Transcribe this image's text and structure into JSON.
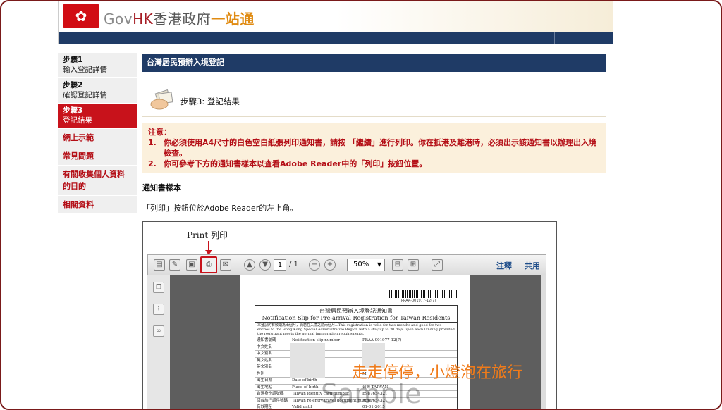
{
  "header": {
    "flag_glyph": "✿",
    "brand_gov": "Gov",
    "brand_hk": "HK",
    "brand_zh": "香港政府",
    "brand_one": "一站通"
  },
  "sidebar": {
    "steps": [
      {
        "title": "步驟1",
        "sub": "輸入登記詳情"
      },
      {
        "title": "步驟2",
        "sub": "確認登記詳情"
      },
      {
        "title": "步驟3",
        "sub": "登記結果"
      }
    ],
    "links": [
      "網上示範",
      "常見問題",
      "有關收集個人資料的目的",
      "相關資料"
    ]
  },
  "main": {
    "title": "台灣居民預辦入境登記",
    "step_label": "步驟3: 登記結果",
    "notice_heading": "注意：",
    "notice_items": [
      "你必須使用A4尺寸的白色空白紙張列印通知書，請按 「繼續」進行列印。你在抵港及離港時，必須出示該通知書以辦理出入境檢查。",
      "你可參考下方的通知書樣本以查看Adobe Reader中的「列印」按鈕位置。"
    ],
    "sample_heading": "通知書樣本",
    "sample_desc": "「列印」按鈕位於Adobe Reader的左上角。"
  },
  "sample": {
    "print_annotation": "Print  列印",
    "page_current": "1",
    "page_total": "/ 1",
    "zoom": "50%",
    "comment_label": "注釋",
    "share_label": "共用",
    "barcode_number": "PRAA-001977-12(7)",
    "form_title_zh": "台灣居民預辦入境登記通知書",
    "form_title_en": "Notification Slip for Pre-arrival Registration for Taiwan Residents",
    "form_intro": "本登記的有效期為兩個月，倘若在入境之前兩個月...This registration is valid for two months and good for two entries to the Hong Kong Special Administrative Region with a stay up to 30 days upon each landing provided the registrant meets the normal immigration requirements.",
    "rows": [
      {
        "zh": "通知書號碼",
        "en": "Notification slip number",
        "val": "PRAA-001977-12(7)"
      },
      {
        "zh": "中文姓名",
        "en": "",
        "val": ""
      },
      {
        "zh": "中文別名",
        "en": "",
        "val": ""
      },
      {
        "zh": "英文姓名",
        "en": "",
        "val": ""
      },
      {
        "zh": "英文別名",
        "en": "",
        "val": ""
      },
      {
        "zh": "性別",
        "en": "",
        "val": "M"
      },
      {
        "zh": "出生日期",
        "en": "Date of birth",
        "val": ""
      },
      {
        "zh": "出生地點",
        "en": "Place of birth",
        "val": "台灣 TAIWAN"
      },
      {
        "zh": "台灣身份證號碼",
        "en": "Taiwan identity card number",
        "val": "B987654321"
      },
      {
        "zh": "回台旅行證件號碼",
        "en": "Taiwan re-entry travel document number",
        "val": "A567654321"
      },
      {
        "zh": "有效期至",
        "en": "Valid until",
        "val": "01-01-2015"
      }
    ],
    "watermark": "走走停停，小燈泡在旅行",
    "ghost_text": "Sample"
  }
}
